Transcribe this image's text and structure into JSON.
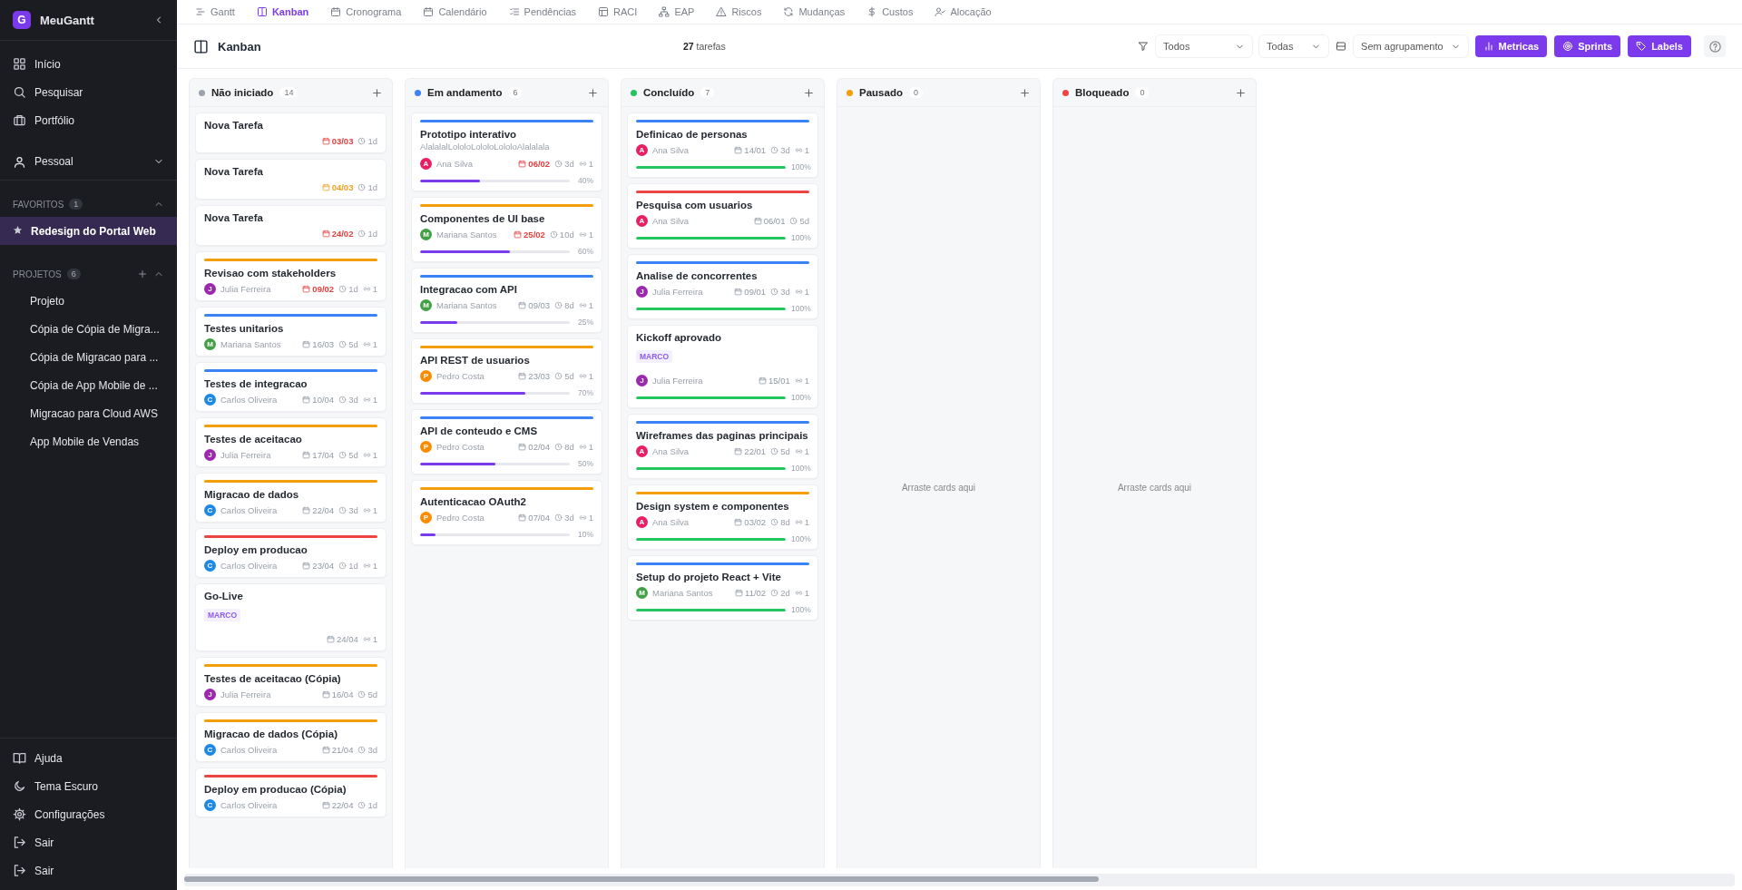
{
  "sidebar": {
    "logo": "G",
    "app_name": "MeuGantt",
    "nav": [
      {
        "label": "Início"
      },
      {
        "label": "Pesquisar"
      },
      {
        "label": "Portfólio"
      }
    ],
    "personal": {
      "label": "Pessoal",
      "expanded": false
    },
    "favorites": {
      "title": "FAVORITOS",
      "count": "1",
      "expanded": true,
      "items": [
        {
          "label": "Redesign do Portal Web",
          "selected": true
        }
      ]
    },
    "projects": {
      "title": "PROJETOS",
      "count": "6",
      "expanded": true,
      "items": [
        {
          "label": "Projeto",
          "selected": false
        },
        {
          "label": "Cópia de Cópia de Migra...",
          "selected": false
        },
        {
          "label": "Cópia de Migracao para ...",
          "selected": false
        },
        {
          "label": "Cópia de App Mobile de ...",
          "selected": false
        },
        {
          "label": "Migracao para Cloud AWS",
          "selected": false
        },
        {
          "label": "App Mobile de Vendas",
          "selected": false
        }
      ]
    },
    "footer": [
      {
        "label": "Ajuda"
      },
      {
        "label": "Tema Escuro"
      },
      {
        "label": "Configurações"
      },
      {
        "label": "Sair"
      },
      {
        "label": "Sair"
      }
    ]
  },
  "tabs": [
    {
      "label": "Gantt",
      "selected": false
    },
    {
      "label": "Kanban",
      "selected": true
    },
    {
      "label": "Cronograma",
      "selected": false
    },
    {
      "label": "Calendário",
      "selected": false
    },
    {
      "label": "Pendências",
      "selected": false
    },
    {
      "label": "RACI",
      "selected": false
    },
    {
      "label": "EAP",
      "selected": false
    },
    {
      "label": "Riscos",
      "selected": false
    },
    {
      "label": "Mudanças",
      "selected": false
    },
    {
      "label": "Custos",
      "selected": false
    },
    {
      "label": "Alocação",
      "selected": false
    }
  ],
  "header": {
    "title": "Kanban",
    "count": "27",
    "count_label": "tarefas",
    "filters": [
      {
        "value": "Todos"
      },
      {
        "value": "Todas"
      },
      {
        "value": "Sem agrupamento"
      }
    ],
    "buttons": [
      {
        "label": "Metricas"
      },
      {
        "label": "Sprints"
      },
      {
        "label": "Labels"
      }
    ]
  },
  "columns": [
    {
      "title": "Não iniciado",
      "count": "14",
      "color": "#9ca3af",
      "cards": [
        {
          "title": "Nova Tarefa",
          "date": "03/03",
          "overdue": true,
          "due_soon": false,
          "duration": "1d"
        },
        {
          "title": "Nova Tarefa",
          "date": "04/03",
          "overdue": false,
          "due_soon": true,
          "duration": "1d"
        },
        {
          "title": "Nova Tarefa",
          "date": "24/02",
          "overdue": true,
          "due_soon": false,
          "duration": "1d"
        },
        {
          "title": "Revisao com stakeholders",
          "color": "#f59e0b",
          "assignee": {
            "initial": "J",
            "name": "Julia Ferreira",
            "color": "#9c27b0"
          },
          "date": "09/02",
          "overdue": true,
          "due_soon": false,
          "duration": "1d",
          "links": "1"
        },
        {
          "title": "Testes unitarios",
          "color": "#3b82f6",
          "assignee": {
            "initial": "M",
            "name": "Mariana Santos",
            "color": "#43a047"
          },
          "date": "16/03",
          "overdue": false,
          "due_soon": false,
          "duration": "5d",
          "links": "1"
        },
        {
          "title": "Testes de integracao",
          "color": "#3b82f6",
          "assignee": {
            "initial": "C",
            "name": "Carlos Oliveira",
            "color": "#1e88e5"
          },
          "date": "10/04",
          "overdue": false,
          "due_soon": false,
          "duration": "3d",
          "links": "1"
        },
        {
          "title": "Testes de aceitacao",
          "color": "#f59e0b",
          "assignee": {
            "initial": "J",
            "name": "Julia Ferreira",
            "color": "#9c27b0"
          },
          "date": "17/04",
          "overdue": false,
          "due_soon": false,
          "duration": "5d",
          "links": "1"
        },
        {
          "title": "Migracao de dados",
          "color": "#f59e0b",
          "assignee": {
            "initial": "C",
            "name": "Carlos Oliveira",
            "color": "#1e88e5"
          },
          "date": "22/04",
          "overdue": false,
          "due_soon": false,
          "duration": "3d",
          "links": "1"
        },
        {
          "title": "Deploy em producao",
          "color": "#ef4444",
          "assignee": {
            "initial": "C",
            "name": "Carlos Oliveira",
            "color": "#1e88e5"
          },
          "date": "23/04",
          "overdue": false,
          "due_soon": false,
          "duration": "1d",
          "links": "1"
        },
        {
          "title": "Go-Live",
          "tag": "MARCO",
          "date": "24/04",
          "overdue": false,
          "due_soon": false,
          "links": "1"
        },
        {
          "title": "Testes de aceitacao (Cópia)",
          "color": "#f59e0b",
          "assignee": {
            "initial": "J",
            "name": "Julia Ferreira",
            "color": "#9c27b0"
          },
          "date": "16/04",
          "overdue": false,
          "due_soon": false,
          "duration": "5d"
        },
        {
          "title": "Migracao de dados (Cópia)",
          "color": "#f59e0b",
          "assignee": {
            "initial": "C",
            "name": "Carlos Oliveira",
            "color": "#1e88e5"
          },
          "date": "21/04",
          "overdue": false,
          "due_soon": false,
          "duration": "3d"
        },
        {
          "title": "Deploy em producao (Cópia)",
          "color": "#ef4444",
          "assignee": {
            "initial": "C",
            "name": "Carlos Oliveira",
            "color": "#1e88e5"
          },
          "date": "22/04",
          "overdue": false,
          "due_soon": false,
          "duration": "1d"
        }
      ]
    },
    {
      "title": "Em andamento",
      "count": "6",
      "color": "#3b82f6",
      "cards": [
        {
          "title": "Prototipo interativo",
          "description": "AlalalalLololoLololoLololoAlalalala",
          "color": "#3b82f6",
          "assignee": {
            "initial": "A",
            "name": "Ana Silva",
            "color": "#e91e63"
          },
          "date": "06/02",
          "overdue": true,
          "due_soon": false,
          "duration": "3d",
          "links": "1",
          "progress": {
            "level": 0.4,
            "text": "40%",
            "color": "#7c3aed"
          }
        },
        {
          "title": "Componentes de UI base",
          "color": "#f59e0b",
          "assignee": {
            "initial": "M",
            "name": "Mariana Santos",
            "color": "#43a047"
          },
          "date": "25/02",
          "overdue": true,
          "due_soon": false,
          "duration": "10d",
          "links": "1",
          "progress": {
            "level": 0.6,
            "text": "60%",
            "color": "#7c3aed"
          }
        },
        {
          "title": "Integracao com API",
          "color": "#3b82f6",
          "assignee": {
            "initial": "M",
            "name": "Mariana Santos",
            "color": "#43a047"
          },
          "date": "09/03",
          "overdue": false,
          "due_soon": false,
          "duration": "8d",
          "links": "1",
          "progress": {
            "level": 0.25,
            "text": "25%",
            "color": "#7c3aed"
          }
        },
        {
          "title": "API REST de usuarios",
          "color": "#f59e0b",
          "assignee": {
            "initial": "P",
            "name": "Pedro Costa",
            "color": "#fb8c00"
          },
          "date": "23/03",
          "overdue": false,
          "due_soon": false,
          "duration": "5d",
          "links": "1",
          "progress": {
            "level": 0.7,
            "text": "70%",
            "color": "#7c3aed"
          }
        },
        {
          "title": "API de conteudo e CMS",
          "color": "#3b82f6",
          "assignee": {
            "initial": "P",
            "name": "Pedro Costa",
            "color": "#fb8c00"
          },
          "date": "02/04",
          "overdue": false,
          "due_soon": false,
          "duration": "8d",
          "links": "1",
          "progress": {
            "level": 0.5,
            "text": "50%",
            "color": "#7c3aed"
          }
        },
        {
          "title": "Autenticacao OAuth2",
          "color": "#f59e0b",
          "assignee": {
            "initial": "P",
            "name": "Pedro Costa",
            "color": "#fb8c00"
          },
          "date": "07/04",
          "overdue": false,
          "due_soon": false,
          "duration": "3d",
          "links": "1",
          "progress": {
            "level": 0.1,
            "text": "10%",
            "color": "#7c3aed"
          }
        }
      ]
    },
    {
      "title": "Concluído",
      "count": "7",
      "color": "#22c55e",
      "cards": [
        {
          "title": "Definicao de personas",
          "color": "#3b82f6",
          "assignee": {
            "initial": "A",
            "name": "Ana Silva",
            "color": "#e91e63"
          },
          "date": "14/01",
          "overdue": false,
          "due_soon": false,
          "duration": "3d",
          "links": "1",
          "progress": {
            "level": 1,
            "text": "100%",
            "color": "#22c55e"
          }
        },
        {
          "title": "Pesquisa com usuarios",
          "color": "#ef4444",
          "assignee": {
            "initial": "A",
            "name": "Ana Silva",
            "color": "#e91e63"
          },
          "date": "06/01",
          "overdue": false,
          "due_soon": false,
          "duration": "5d",
          "progress": {
            "level": 1,
            "text": "100%",
            "color": "#22c55e"
          }
        },
        {
          "title": "Analise de concorrentes",
          "color": "#3b82f6",
          "assignee": {
            "initial": "J",
            "name": "Julia Ferreira",
            "color": "#9c27b0"
          },
          "date": "09/01",
          "overdue": false,
          "due_soon": false,
          "duration": "3d",
          "links": "1",
          "progress": {
            "level": 1,
            "text": "100%",
            "color": "#22c55e"
          }
        },
        {
          "title": "Kickoff aprovado",
          "tag": "MARCO",
          "assignee": {
            "initial": "J",
            "name": "Julia Ferreira",
            "color": "#9c27b0"
          },
          "date": "15/01",
          "overdue": false,
          "due_soon": false,
          "links": "1",
          "progress": {
            "level": 1,
            "text": "100%",
            "color": "#22c55e"
          }
        },
        {
          "title": "Wireframes das paginas principais",
          "color": "#3b82f6",
          "assignee": {
            "initial": "A",
            "name": "Ana Silva",
            "color": "#e91e63"
          },
          "date": "22/01",
          "overdue": false,
          "due_soon": false,
          "duration": "5d",
          "links": "1",
          "progress": {
            "level": 1,
            "text": "100%",
            "color": "#22c55e"
          }
        },
        {
          "title": "Design system e componentes",
          "color": "#f59e0b",
          "assignee": {
            "initial": "A",
            "name": "Ana Silva",
            "color": "#e91e63"
          },
          "date": "03/02",
          "overdue": false,
          "due_soon": false,
          "duration": "8d",
          "links": "1",
          "progress": {
            "level": 1,
            "text": "100%",
            "color": "#22c55e"
          }
        },
        {
          "title": "Setup do projeto React + Vite",
          "color": "#3b82f6",
          "assignee": {
            "initial": "M",
            "name": "Mariana Santos",
            "color": "#43a047"
          },
          "date": "11/02",
          "overdue": false,
          "due_soon": false,
          "duration": "2d",
          "links": "1",
          "progress": {
            "level": 1,
            "text": "100%",
            "color": "#22c55e"
          }
        }
      ]
    },
    {
      "title": "Pausado",
      "count": "0",
      "color": "#f59e0b",
      "empty_text": "Arraste cards aqui"
    },
    {
      "title": "Bloqueado",
      "count": "0",
      "color": "#ef4444",
      "empty_text": "Arraste cards aqui"
    }
  ]
}
